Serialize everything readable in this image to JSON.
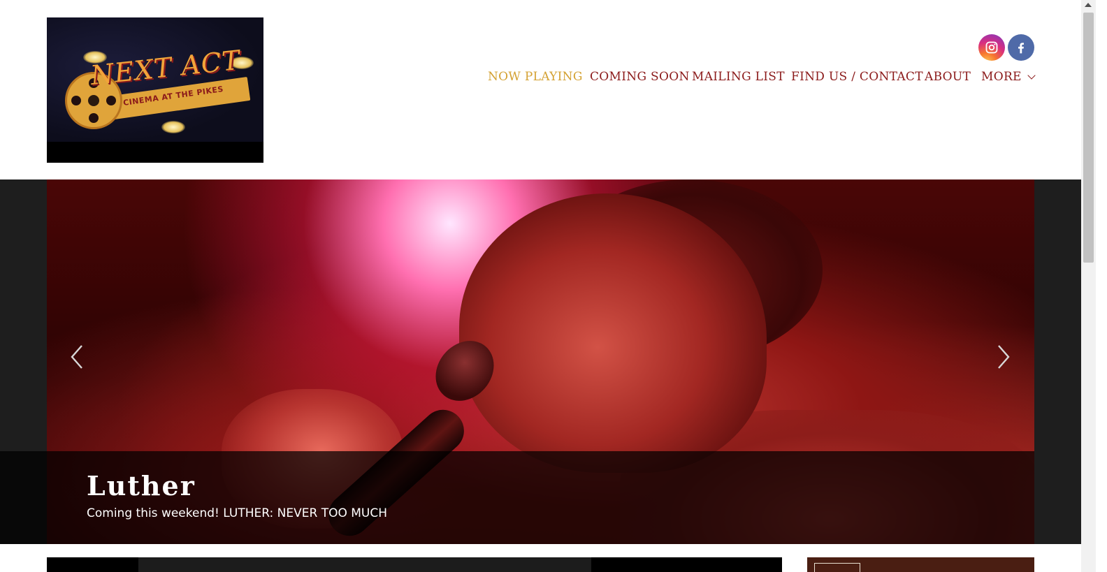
{
  "header": {
    "logo": {
      "name": "NEXT ACT",
      "tagline": "CINEMA AT THE PIKES"
    },
    "social": [
      {
        "icon": "instagram-icon",
        "label": "Instagram"
      },
      {
        "icon": "facebook-icon",
        "label": "Facebook"
      }
    ],
    "nav": [
      {
        "label": "NOW PLAYING",
        "active": true
      },
      {
        "label": "COMING SOON",
        "active": false
      },
      {
        "label": "MAILING LIST",
        "active": false
      },
      {
        "label": "FIND US / CONTACT",
        "active": false
      },
      {
        "label": "ABOUT",
        "active": false
      },
      {
        "label": "MORE",
        "active": false,
        "has_dropdown": true
      }
    ]
  },
  "hero": {
    "title": "Luther",
    "subtitle": "Coming this weekend! LUTHER: NEVER TOO MUCH",
    "prev_icon": "chevron-left-icon",
    "next_icon": "chevron-right-icon"
  },
  "colors": {
    "nav_text": "#8b1a1a",
    "nav_active": "#d4a132",
    "hero_band": "#1e1e1e",
    "instagram": "#d92e7f",
    "facebook": "#4f6aa8"
  }
}
